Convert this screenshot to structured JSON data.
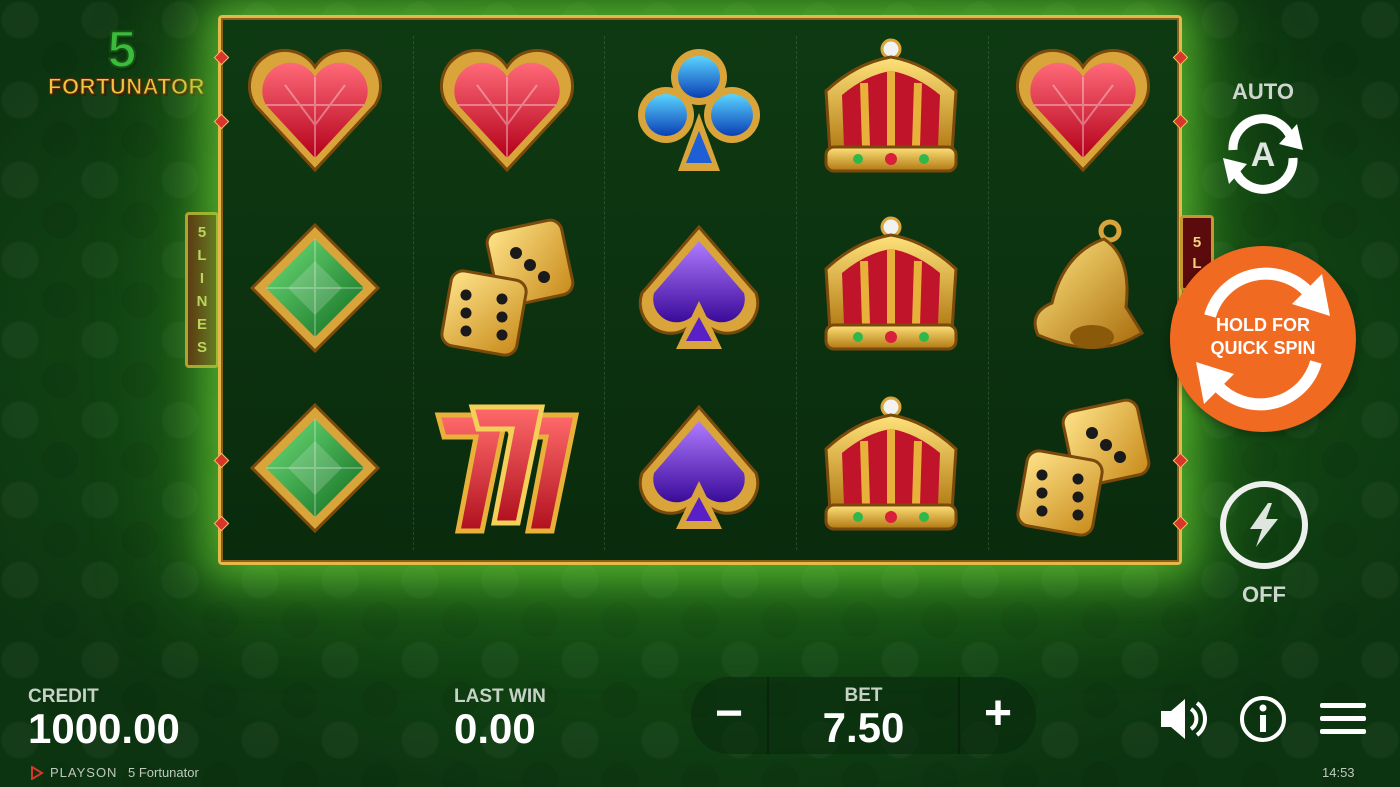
{
  "game": {
    "logo_number": "5",
    "logo_word": "FORTUNATOR",
    "lines_left": [
      "5",
      "L",
      "I",
      "N",
      "E",
      "S"
    ],
    "lines_right": [
      "5",
      "L"
    ]
  },
  "reels": [
    [
      "heart-gem-icon",
      "diamond-gem-icon",
      "diamond-gem-icon"
    ],
    [
      "heart-gem-icon",
      "dice-icon",
      "lucky-seven-icon"
    ],
    [
      "club-gem-icon",
      "spade-gem-icon",
      "spade-gem-icon"
    ],
    [
      "crown-icon",
      "crown-icon",
      "crown-icon"
    ],
    [
      "heart-gem-icon",
      "bell-icon",
      "dice-icon"
    ]
  ],
  "controls": {
    "auto_label": "AUTO",
    "auto_letter": "A",
    "spin_line1": "HOLD FOR",
    "spin_line2": "QUICK SPIN",
    "quick_label": "OFF"
  },
  "bottom": {
    "credit_label": "CREDIT",
    "credit_value": "1000.00",
    "last_win_label": "LAST WIN",
    "last_win_value": "0.00",
    "bet_label": "BET",
    "bet_value": "7.50",
    "minus": "−",
    "plus": "+"
  },
  "footer": {
    "provider": "PLAYSON",
    "game_name": "5 Fortunator",
    "time": "14:53"
  },
  "colors": {
    "accent_orange": "#f06a22",
    "frame_gold": "#e2b94a",
    "table_green": "#134a14"
  }
}
